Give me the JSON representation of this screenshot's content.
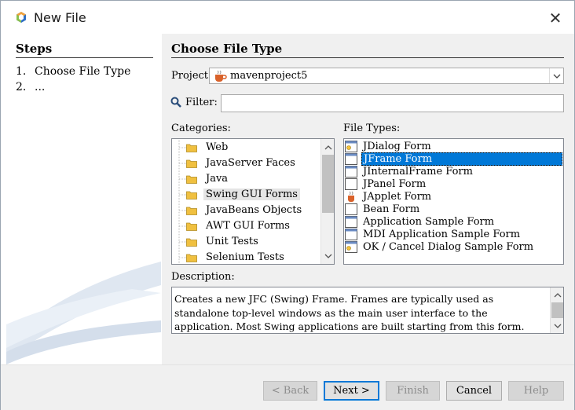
{
  "window": {
    "title": "New File"
  },
  "steps": {
    "heading": "Steps",
    "items": [
      {
        "num": "1.",
        "label": "Choose File Type"
      },
      {
        "num": "2.",
        "label": "..."
      }
    ]
  },
  "main": {
    "heading": "Choose File Type",
    "project_label": "Project:",
    "project_value": "mavenproject5",
    "filter_label": "Filter:",
    "filter_value": "",
    "categories_label": "Categories:",
    "categories": [
      "Web",
      "JavaServer Faces",
      "Java",
      "Swing GUI Forms",
      "JavaBeans Objects",
      "AWT GUI Forms",
      "Unit Tests",
      "Selenium Tests"
    ],
    "selected_category": "Swing GUI Forms",
    "file_types_label": "File Types:",
    "file_types": [
      {
        "label": "JDialog Form",
        "icon": "dialog-icon"
      },
      {
        "label": "JFrame Form",
        "icon": "frame-icon"
      },
      {
        "label": "JInternalFrame Form",
        "icon": "frame-icon"
      },
      {
        "label": "JPanel Form",
        "icon": "panel-icon"
      },
      {
        "label": "JApplet Form",
        "icon": "applet-icon"
      },
      {
        "label": "Bean Form",
        "icon": "panel-icon"
      },
      {
        "label": "Application Sample Form",
        "icon": "frame-icon"
      },
      {
        "label": "MDI Application Sample Form",
        "icon": "frame-icon"
      },
      {
        "label": "OK / Cancel Dialog Sample Form",
        "icon": "dialog-icon"
      }
    ],
    "selected_file_type": "JFrame Form",
    "description_label": "Description:",
    "description": "Creates a new JFC (Swing) Frame. Frames are typically used as standalone top-level windows as the main user interface to the application. Most Swing applications are built starting from this form."
  },
  "buttons": {
    "back": "< Back",
    "next": "Next >",
    "finish": "Finish",
    "cancel": "Cancel",
    "help": "Help"
  },
  "colors": {
    "selection": "#0078d7",
    "folder": "#f0c040"
  }
}
